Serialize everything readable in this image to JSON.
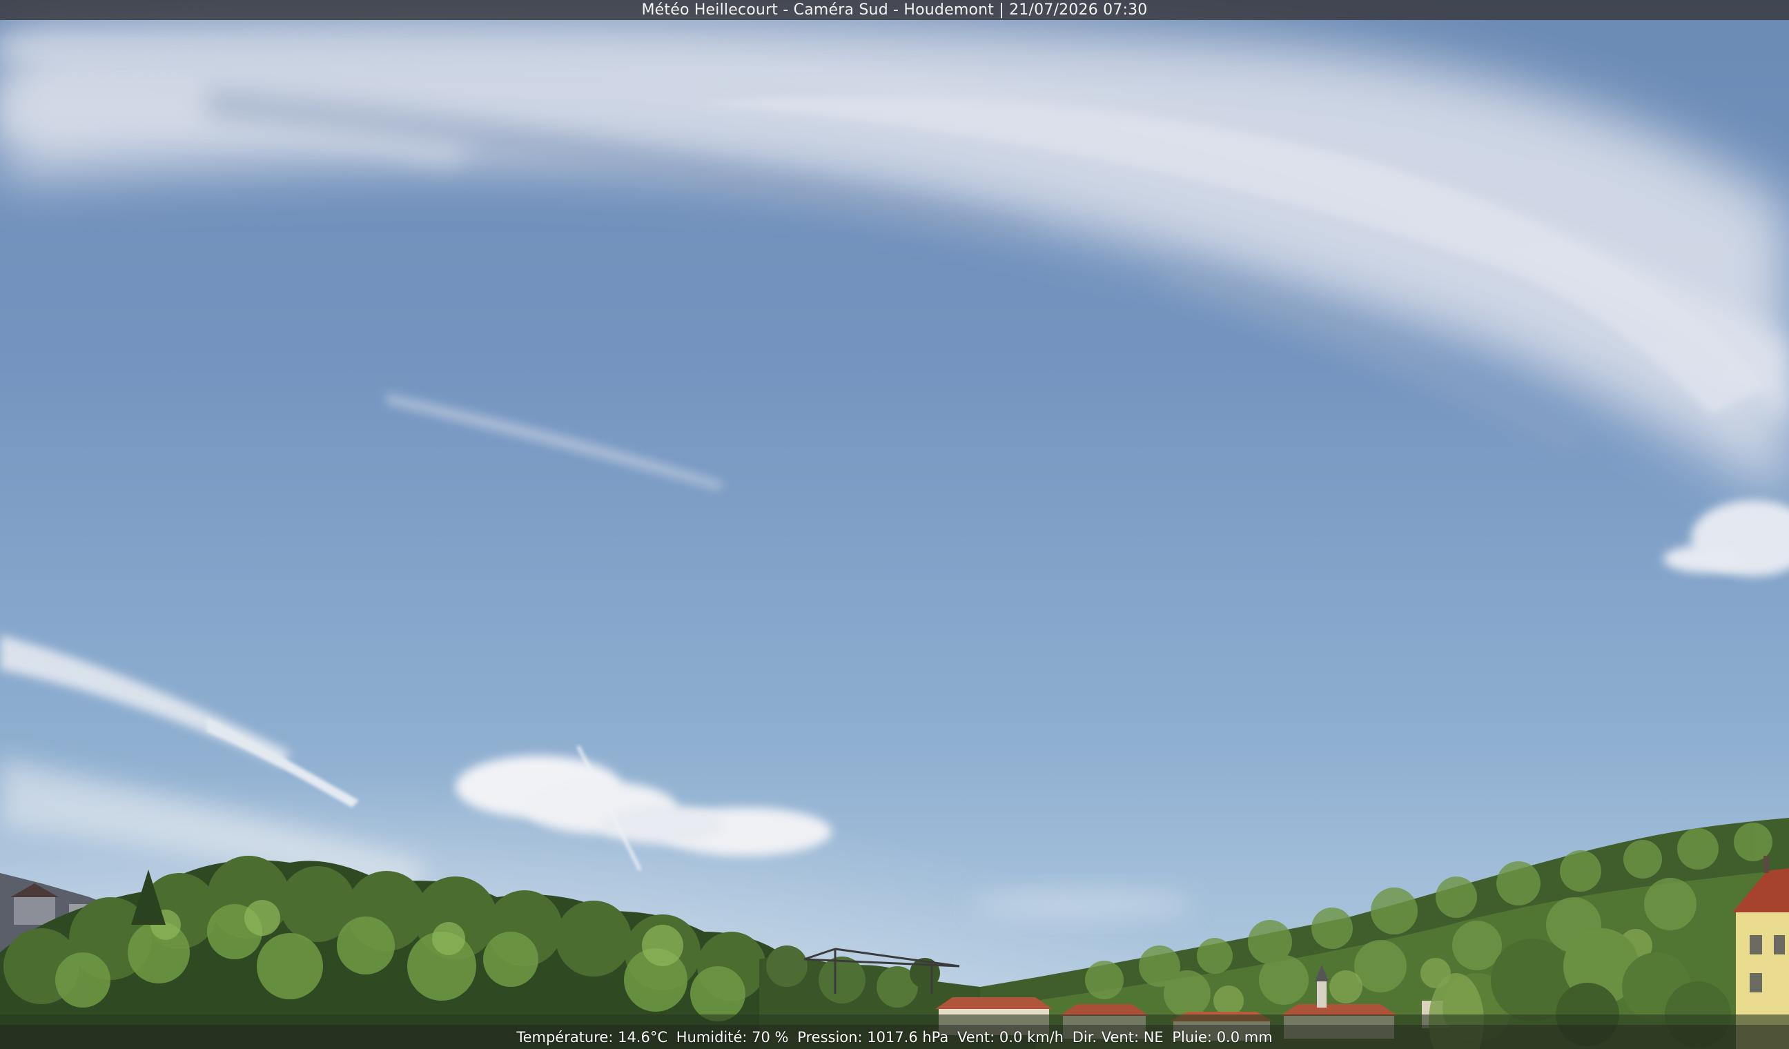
{
  "overlay": {
    "title": "Météo Heillecourt - Caméra Sud - Houdemont | 21/07/2026 07:30",
    "weather": {
      "temperature": "Température: 14.6°C",
      "humidity": "Humidité: 70 %",
      "pressure": "Pression: 1017.6 hPa",
      "wind_speed": "Vent: 0.0 km/h",
      "wind_dir": "Dir. Vent: NE",
      "rain": "Pluie: 0.0 mm"
    }
  },
  "colors": {
    "sky_top": "#6f8fb9",
    "sky_mid": "#7f9ec4",
    "sky_horizon": "#b2cbe0",
    "cloud": "#e4e6ee",
    "trees_dark": "#2f4a22",
    "trees_light": "#6f9a45",
    "roofs": "#b0553c",
    "house_wall": "#e9dc8e"
  }
}
